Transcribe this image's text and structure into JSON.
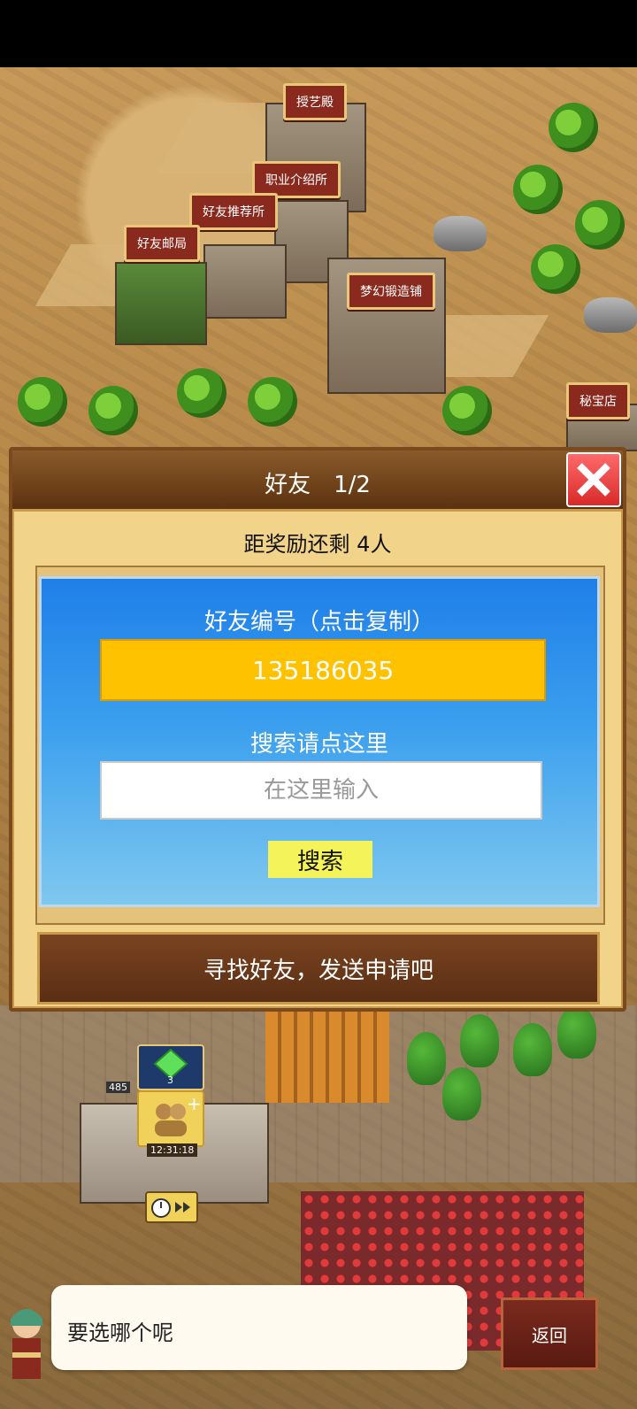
{
  "map": {
    "signs": [
      "授艺殿",
      "职业介绍所",
      "好友推荐所",
      "好友邮局",
      "梦幻锻造铺",
      "秘宝店"
    ]
  },
  "hud": {
    "gem_count": "3",
    "timer_text": "12:31:18",
    "small_count": "485"
  },
  "dialog": {
    "title": "好友　1/2",
    "reward_remaining": "距奖励还剩 4人",
    "friend_id_heading": "好友编号（点击复制）",
    "friend_id": "135186035",
    "search_heading": "搜索请点这里",
    "search_placeholder": "在这里输入",
    "search_button": "搜索",
    "find_button": "寻找好友，发送申请吧"
  },
  "chat": {
    "message": "要选哪个呢",
    "back_button": "返回"
  },
  "colors": {
    "accent_yellow": "#ffc200",
    "blue_panel": "#1f7fe8",
    "close_red": "#e43a3a"
  }
}
